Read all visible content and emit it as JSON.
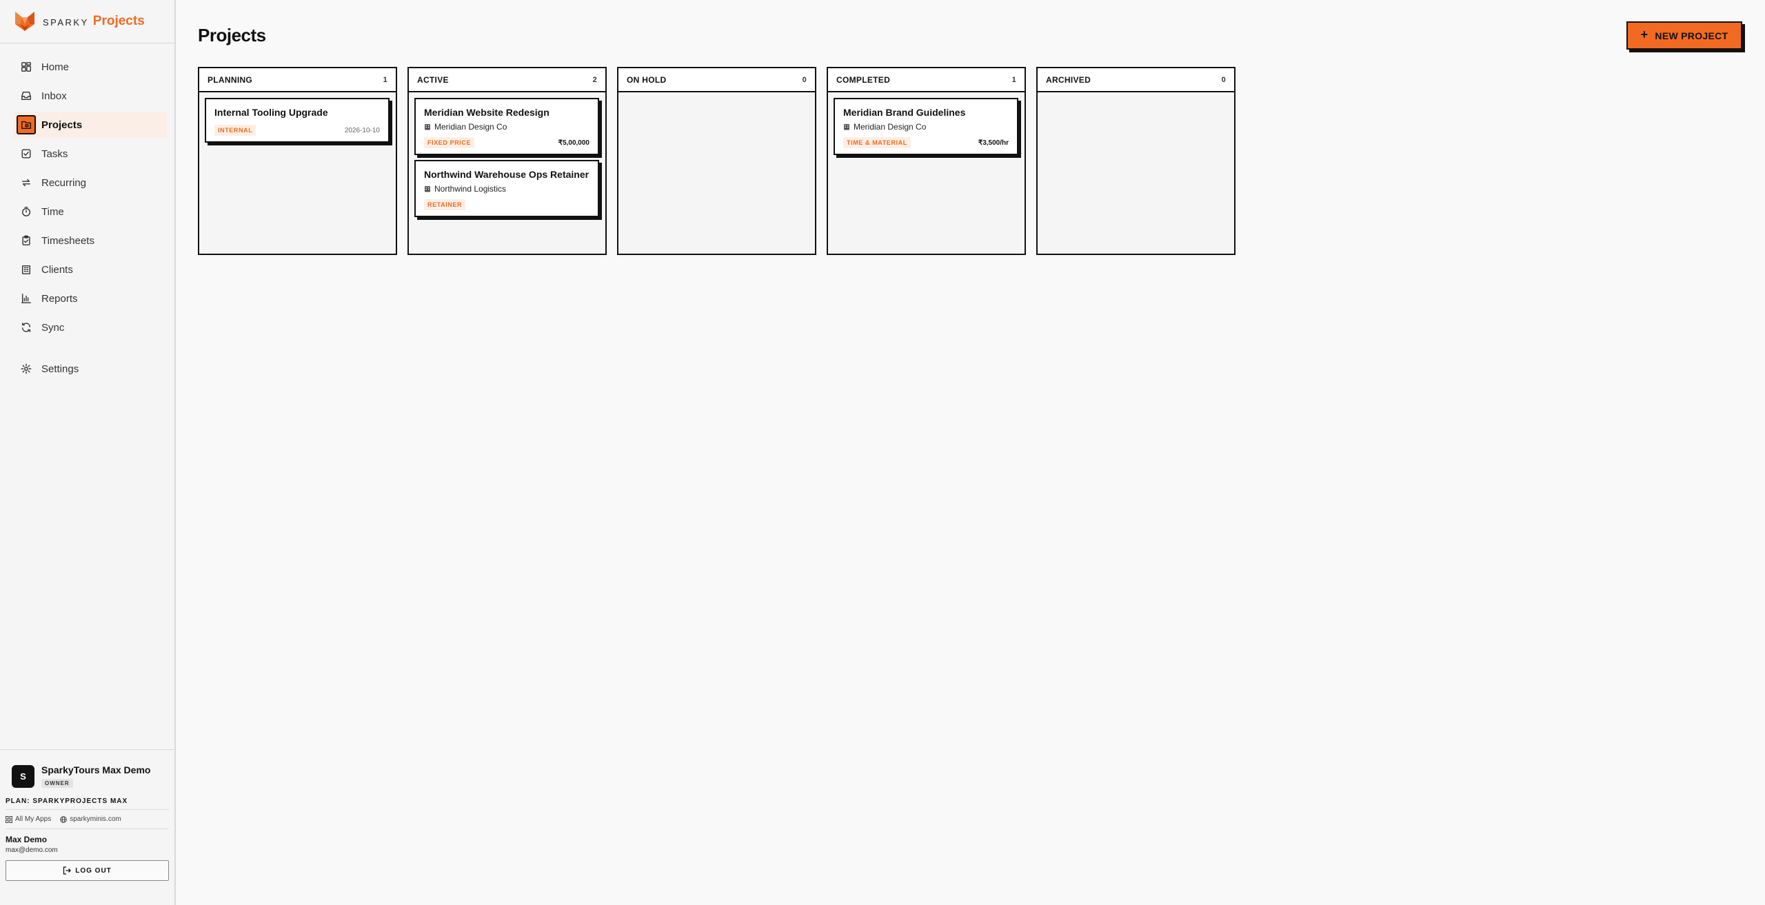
{
  "brand": {
    "prefix": "SPARKY",
    "name": "Projects"
  },
  "nav": {
    "items": [
      {
        "label": "Home",
        "icon": "dashboard-icon"
      },
      {
        "label": "Inbox",
        "icon": "inbox-icon"
      },
      {
        "label": "Projects",
        "icon": "folder-icon",
        "active": true
      },
      {
        "label": "Tasks",
        "icon": "checkbox-icon"
      },
      {
        "label": "Recurring",
        "icon": "repeat-icon"
      },
      {
        "label": "Time",
        "icon": "stopwatch-icon"
      },
      {
        "label": "Timesheets",
        "icon": "clipboard-icon"
      },
      {
        "label": "Clients",
        "icon": "building-icon"
      },
      {
        "label": "Reports",
        "icon": "bar-chart-icon"
      },
      {
        "label": "Sync",
        "icon": "sync-icon"
      }
    ],
    "settings": {
      "label": "Settings",
      "icon": "gear-icon"
    }
  },
  "org": {
    "initial": "S",
    "name": "SparkyTours Max Demo",
    "role": "OWNER"
  },
  "plan": "PLAN: SPARKYPROJECTS MAX",
  "links": {
    "apps": "All My Apps",
    "site": "sparkyminis.com"
  },
  "user": {
    "name": "Max Demo",
    "email": "max@demo.com"
  },
  "logout": "LOG OUT",
  "main": {
    "title": "Projects",
    "new_button": "NEW PROJECT"
  },
  "colors": {
    "accent": "#f26a21",
    "accent_soft": "#feeee4",
    "ink": "#111111"
  },
  "columns": [
    {
      "title": "PLANNING",
      "count": "1",
      "cards": [
        {
          "title": "Internal Tooling Upgrade",
          "client": "",
          "tag": "INTERNAL",
          "meta": "2026-10-10",
          "meta_kind": "date"
        }
      ]
    },
    {
      "title": "ACTIVE",
      "count": "2",
      "cards": [
        {
          "title": "Meridian Website Redesign",
          "client": "Meridian Design Co",
          "tag": "FIXED PRICE",
          "meta": "₹5,00,000",
          "meta_kind": "price"
        },
        {
          "title": "Northwind Warehouse Ops Retainer",
          "client": "Northwind Logistics",
          "tag": "RETAINER",
          "meta": "",
          "meta_kind": "price"
        }
      ]
    },
    {
      "title": "ON HOLD",
      "count": "0",
      "cards": []
    },
    {
      "title": "COMPLETED",
      "count": "1",
      "cards": [
        {
          "title": "Meridian Brand Guidelines",
          "client": "Meridian Design Co",
          "tag": "TIME & MATERIAL",
          "meta": "₹3,500/hr",
          "meta_kind": "price"
        }
      ]
    },
    {
      "title": "ARCHIVED",
      "count": "0",
      "cards": []
    }
  ]
}
